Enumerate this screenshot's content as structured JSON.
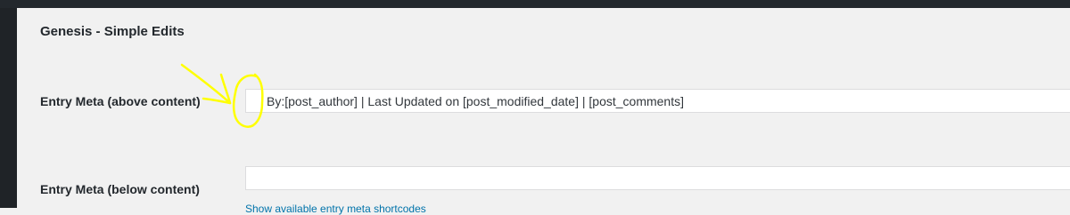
{
  "panel": {
    "title": "Genesis - Simple Edits"
  },
  "fields": {
    "entry_meta_above": {
      "label": "Entry Meta (above content)",
      "value": "By:[post_author] | Last Updated on [post_modified_date] | [post_comments]"
    },
    "entry_meta_below": {
      "label": "Entry Meta (below content)",
      "value": ""
    }
  },
  "links": {
    "show_shortcodes": "Show available entry meta shortcodes"
  },
  "colors": {
    "annotation": "#ffff00",
    "link": "#0073aa",
    "admin_bar": "#23282d"
  }
}
